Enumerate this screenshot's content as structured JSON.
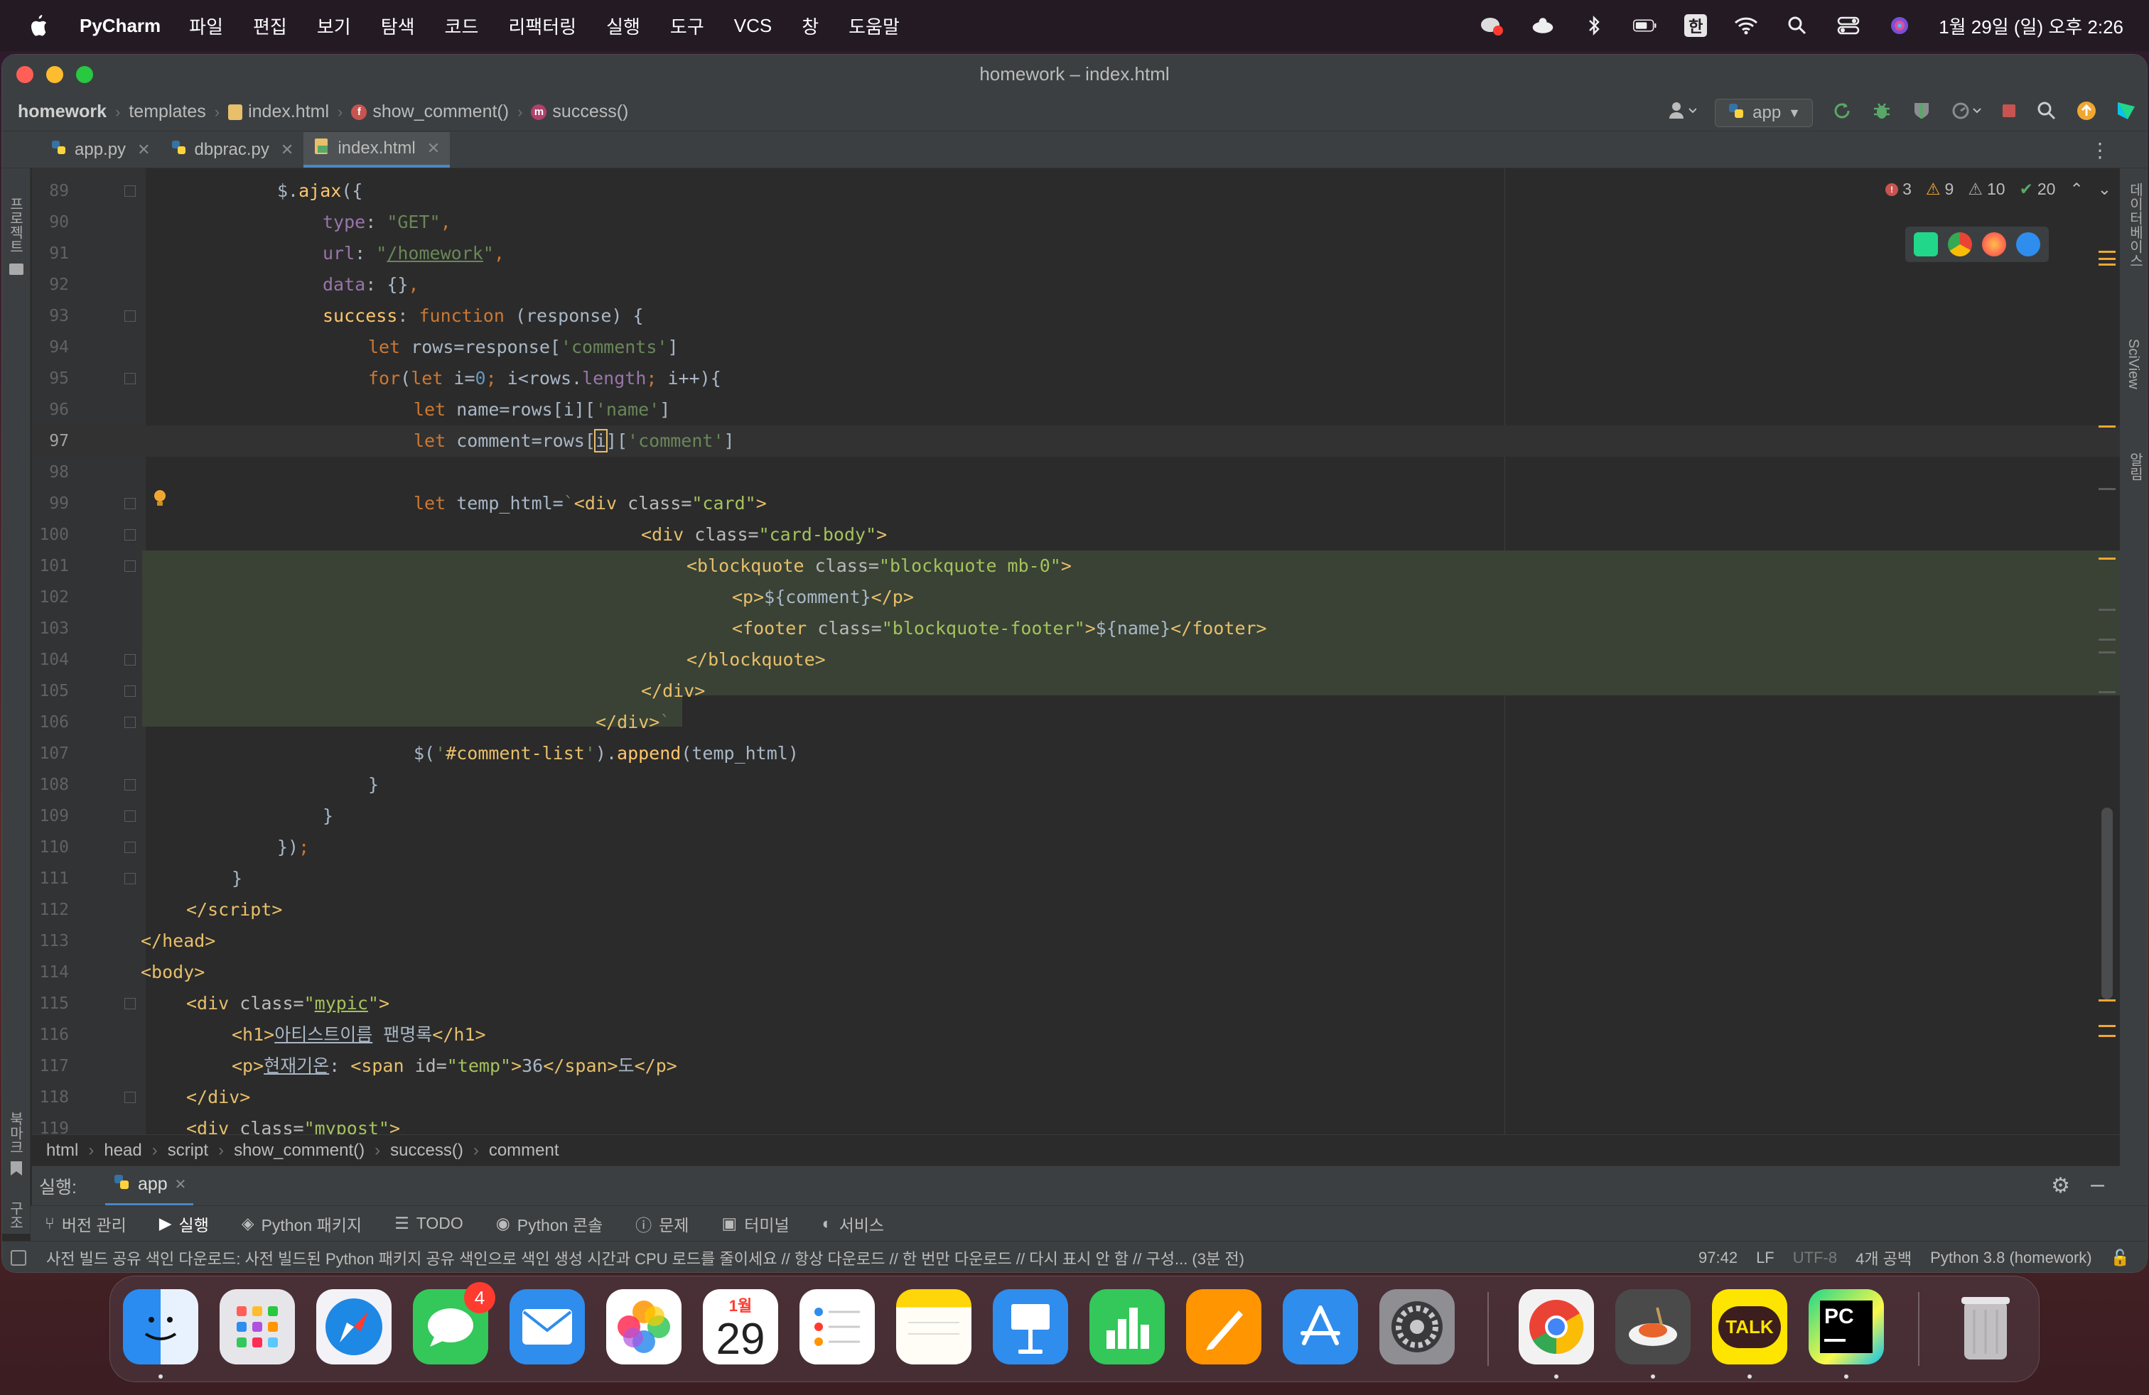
{
  "menubar": {
    "app": "PyCharm",
    "items": [
      "파일",
      "편집",
      "보기",
      "탐색",
      "코드",
      "리팩터링",
      "실행",
      "도구",
      "VCS",
      "창",
      "도움말"
    ],
    "clock": "1월 29일 (일) 오후 2:26",
    "input_source": "한"
  },
  "window": {
    "title": "homework – index.html"
  },
  "nav": {
    "project": "homework",
    "crumbs": [
      "templates",
      "index.html",
      "show_comment()",
      "success()"
    ],
    "run_config": "app"
  },
  "tabs": [
    {
      "label": "app.py"
    },
    {
      "label": "dbprac.py"
    },
    {
      "label": "index.html"
    }
  ],
  "side": {
    "left_top": "프로젝트",
    "left_bottom1": "북마크",
    "left_bottom2": "구조",
    "right_top": "데이터베이스",
    "right_mid": "SciView",
    "right_bot": "알림"
  },
  "inspections": {
    "errors": "3",
    "warnings": "9",
    "weak": "10",
    "ok": "20"
  },
  "code": {
    "l89": "89",
    "l90": "90",
    "l91": "91",
    "l92": "92",
    "l93": "93",
    "l94": "94",
    "l95": "95",
    "l96": "96",
    "l97": "97",
    "l98": "98",
    "l99": "99",
    "l100": "100",
    "l101": "101",
    "l102": "102",
    "l103": "103",
    "l104": "104",
    "l105": "105",
    "l106": "106",
    "l107": "107",
    "l108": "108",
    "l109": "109",
    "l110": "110",
    "l111": "111",
    "l112": "112",
    "l113": "113",
    "l114": "114",
    "l115": "115",
    "l116": "116",
    "l117": "117",
    "l118": "118",
    "l119": "119"
  },
  "editor_breadcrumb": [
    "html",
    "head",
    "script",
    "show_comment()",
    "success()",
    "comment"
  ],
  "run": {
    "label": "실행:",
    "tab": "app"
  },
  "toolwindows": [
    "버전 관리",
    "실행",
    "Python 패키지",
    "TODO",
    "Python 콘솔",
    "문제",
    "터미널",
    "서비스"
  ],
  "status": {
    "message": "사전 빌드 공유 색인 다운로드: 사전 빌드된 Python 패키지 공유 색인으로 색인 생성 시간과 CPU 로드를 줄이세요 // 항상 다운로드 // 한 번만 다운로드 // 다시 표시 안 함 // 구성... (3분 전)",
    "position": "97:42",
    "line_sep": "LF",
    "encoding": "UTF-8",
    "indent": "4개 공백",
    "interpreter": "Python 3.8 (homework)"
  },
  "dock": {
    "messages_badge": "4",
    "calendar_month": "1월",
    "calendar_day": "29",
    "talk": "TALK",
    "pc": "PC"
  }
}
